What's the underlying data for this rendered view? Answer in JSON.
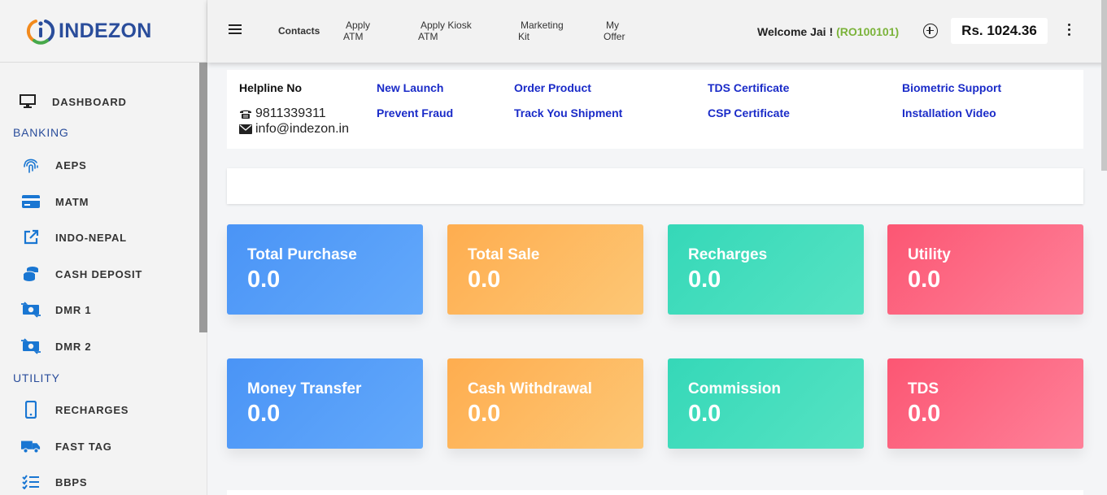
{
  "brand": {
    "name": "INDEZON"
  },
  "sidebar": {
    "dashboard": "DASHBOARD",
    "sections": {
      "banking": "BANKING",
      "utility": "UTILITY"
    },
    "banking_items": [
      "AEPS",
      "MATM",
      "INDO-NEPAL",
      "CASH DEPOSIT",
      "DMR 1",
      "DMR 2"
    ],
    "utility_items": [
      "RECHARGES",
      "FAST TAG",
      "BBPS"
    ]
  },
  "header": {
    "links": [
      {
        "line1": "Contacts",
        "line2": ""
      },
      {
        "line1": "Apply",
        "line2": "ATM"
      },
      {
        "line1": "Apply Kiosk",
        "line2": "ATM"
      },
      {
        "line1": "Marketing",
        "line2": "Kit"
      },
      {
        "line1": "My",
        "line2": "Offer"
      }
    ],
    "welcome": "Welcome Jai !",
    "user_code": "(RO100101)",
    "balance": "Rs. 1024.36"
  },
  "info": {
    "helpline_title": "Helpline No",
    "phone": "9811339311",
    "email": "info@indezon.in",
    "links": [
      "New Launch",
      "Prevent Fraud",
      "Order Product",
      "Track You Shipment",
      "TDS Certificate",
      "CSP Certificate",
      "Biometric Support",
      "Installation Video"
    ]
  },
  "stats": [
    {
      "title": "Total Purchase",
      "value": "0.0"
    },
    {
      "title": "Total Sale",
      "value": "0.0"
    },
    {
      "title": "Recharges",
      "value": "0.0"
    },
    {
      "title": "Utility",
      "value": "0.0"
    },
    {
      "title": "Money Transfer",
      "value": "0.0"
    },
    {
      "title": "Cash Withdrawal",
      "value": "0.0"
    },
    {
      "title": "Commission",
      "value": "0.0"
    },
    {
      "title": "TDS",
      "value": "0.0"
    }
  ],
  "colors": {
    "brand_blue": "#2a4d9b",
    "link_blue": "#1a2bc8",
    "user_code_green": "#7bb33a",
    "icon_blue": "#1976d2"
  }
}
